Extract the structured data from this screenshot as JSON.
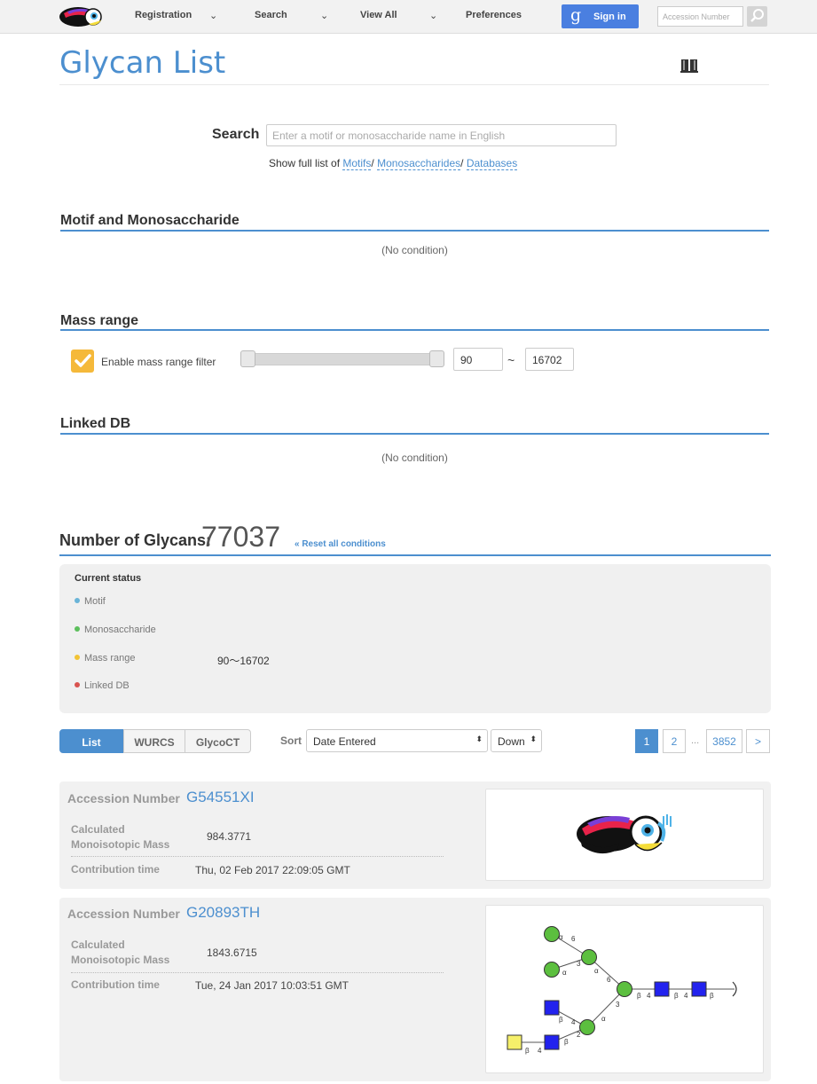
{
  "nav": {
    "items": [
      "Registration",
      "Search",
      "View All",
      "Preferences"
    ],
    "signin_g": "g",
    "signin_label": "Sign in",
    "accession_placeholder": "Accession Number"
  },
  "page": {
    "title": "Glycan List"
  },
  "search": {
    "label": "Search",
    "placeholder": "Enter a motif or monosaccharide name in English",
    "fulllist_prefix": "Show full list of",
    "links": [
      "Motifs",
      "Monosaccharides",
      "Databases"
    ],
    "separator": "/"
  },
  "sections": {
    "motif": {
      "title": "Motif and Monosaccharide",
      "empty": "(No condition)"
    },
    "mass": {
      "title": "Mass range",
      "checkbox_label": "Enable mass range filter",
      "min": "90",
      "max": "16702",
      "tilde": "~",
      "checked": true
    },
    "linked": {
      "title": "Linked DB",
      "empty": "(No condition)"
    }
  },
  "count": {
    "label": "Number of Glycans:",
    "value": "77037",
    "reset": "« Reset all conditions"
  },
  "status": {
    "title": "Current status",
    "rows": [
      {
        "label": "Motif",
        "color": "#6ab4d8",
        "value": ""
      },
      {
        "label": "Monosaccharide",
        "color": "#5cbf5c",
        "value": ""
      },
      {
        "label": "Mass range",
        "color": "#f2c335",
        "value": "90〜16702"
      },
      {
        "label": "Linked DB",
        "color": "#d9534f",
        "value": ""
      }
    ]
  },
  "toolbar": {
    "formats": [
      "List",
      "WURCS",
      "GlycoCT"
    ],
    "active_format": "List",
    "sort_label": "Sort",
    "sort_value": "Date Entered",
    "order_value": "Down",
    "pages": [
      "1",
      "2",
      "3852"
    ],
    "ellipsis": "...",
    "next": ">",
    "current_page": "1"
  },
  "results": [
    {
      "accession_label": "Accession Number",
      "accession": "G54551XI",
      "mass_label_1": "Calculated",
      "mass_label_2": "Monoisotopic Mass",
      "mass": "984.3771",
      "time_label": "Contribution time",
      "time": "Thu, 02 Feb 2017 22:09:05 GMT",
      "image": "toucan-placeholder"
    },
    {
      "accession_label": "Accession Number",
      "accession": "G20893TH",
      "mass_label_1": "Calculated",
      "mass_label_2": "Monoisotopic Mass",
      "mass": "1843.6715",
      "time_label": "Contribution time",
      "time": "Tue, 24 Jan 2017 10:03:51 GMT",
      "image": "glycan-structure"
    }
  ],
  "glycan_labels": {
    "alpha": "α",
    "beta": "β",
    "n6": "6",
    "n3": "3",
    "n4": "4",
    "n2": "2"
  },
  "colors": {
    "accent": "#4c8fcf",
    "checkbox": "#f5b93a",
    "signin": "#4a7fe0",
    "mannose": "#5cbf3f",
    "glcnac": "#2222ee",
    "galnac": "#f6f06a"
  }
}
